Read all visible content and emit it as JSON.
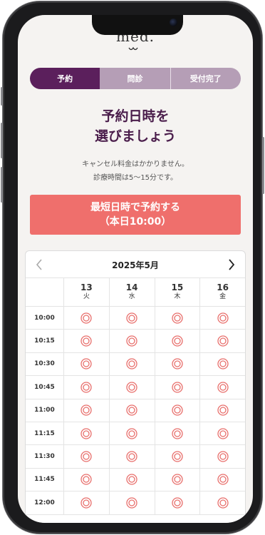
{
  "brand": {
    "logo_text": "med."
  },
  "steps": [
    {
      "label": "予約",
      "active": true
    },
    {
      "label": "問診",
      "active": false
    },
    {
      "label": "受付完了",
      "active": false
    }
  ],
  "heading": {
    "line1": "予約日時を",
    "line2": "選びましょう"
  },
  "notes": {
    "line1": "キャンセル料金はかかりません。",
    "line2": "診療時間は5〜15分です。"
  },
  "cta": {
    "line1": "最短日時で予約する",
    "line2": "（本日10:00）"
  },
  "calendar": {
    "month_label": "2025年5月",
    "prev_icon": "chevron-left-icon",
    "next_icon": "chevron-right-icon",
    "days": [
      {
        "date": "13",
        "weekday": "火"
      },
      {
        "date": "14",
        "weekday": "水"
      },
      {
        "date": "15",
        "weekday": "木"
      },
      {
        "date": "16",
        "weekday": "金"
      }
    ],
    "times": [
      "10:00",
      "10:15",
      "10:30",
      "10:45",
      "11:00",
      "11:15",
      "11:30",
      "11:45",
      "12:00"
    ],
    "slot_symbol": "available-double-circle-icon"
  },
  "colors": {
    "primary": "#5b1f5c",
    "primary_light": "#b59eb6",
    "accent": "#ef6f6c",
    "available": "#e8706d"
  }
}
